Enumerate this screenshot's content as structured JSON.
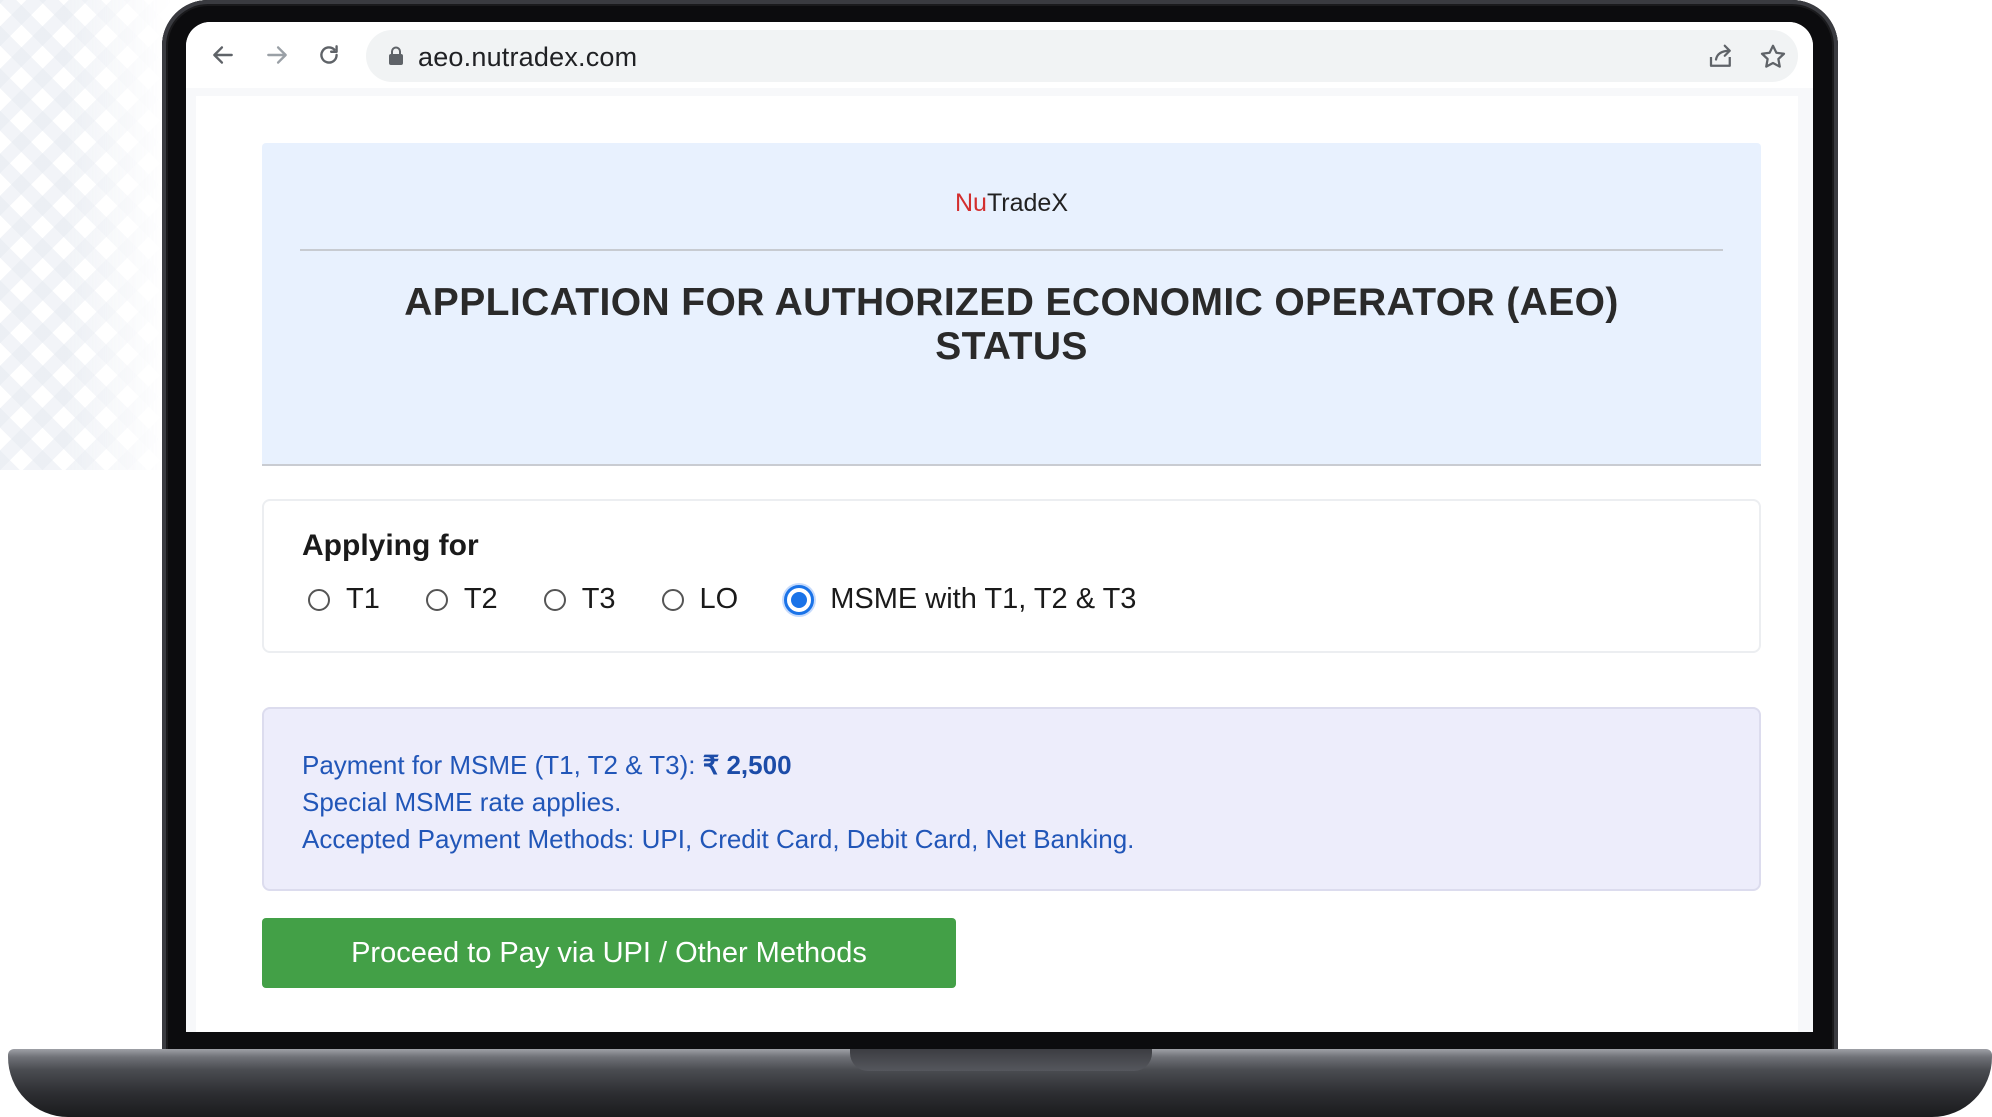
{
  "browser": {
    "url": "aeo.nutradex.com",
    "icons": [
      "back-arrow-icon",
      "forward-arrow-icon",
      "reload-icon",
      "lock-icon",
      "share-icon",
      "star-icon"
    ]
  },
  "header": {
    "brand_prefix": "Nu",
    "brand_suffix": "TradeX",
    "title_line1": "APPLICATION FOR AUTHORIZED ECONOMIC OPERATOR (AEO)",
    "title_line2": "STATUS"
  },
  "applying": {
    "label": "Applying for",
    "options": [
      {
        "label": "T1",
        "checked": false
      },
      {
        "label": "T2",
        "checked": false
      },
      {
        "label": "T3",
        "checked": false
      },
      {
        "label": "LO",
        "checked": false
      },
      {
        "label": "MSME with T1, T2 & T3",
        "checked": true
      }
    ]
  },
  "payment": {
    "line1_prefix": "Payment for MSME (T1, T2 & T3): ",
    "amount": "₹ 2,500",
    "line2": "Special MSME rate applies.",
    "line3": "Accepted Payment Methods: UPI, Credit Card, Debit Card, Net Banking."
  },
  "actions": {
    "proceed_label": "Proceed to Pay via UPI / Other Methods"
  },
  "colors": {
    "brand_red": "#d32f2f",
    "header_bg": "#e8f1fe",
    "payment_bg": "#ededfb",
    "payment_text": "#2156b8",
    "radio_selected": "#1a73e8",
    "proceed_green": "#43a047"
  }
}
